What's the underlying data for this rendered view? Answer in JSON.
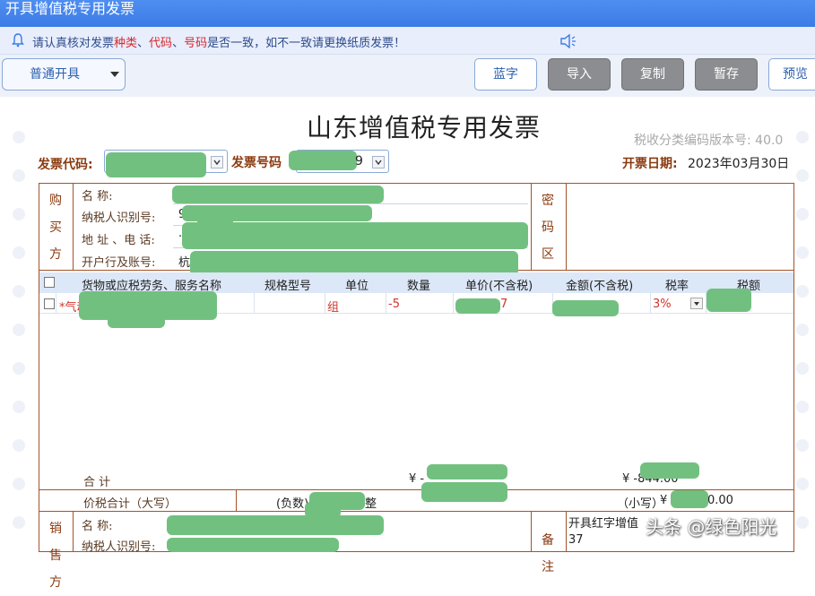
{
  "window": {
    "title": "开具增值税专用发票"
  },
  "notice": {
    "prefix": "请认真核对发票",
    "kind": "种类",
    "sep1": "、",
    "code": "代码",
    "sep2": "、",
    "number": "号码",
    "suffix": "是否一致，如不一致请更换纸质发票！"
  },
  "toolbar": {
    "mode_select": "普通开具",
    "buttons": {
      "blue": "蓝字",
      "import": "导入",
      "copy": "复制",
      "save_draft": "暂存",
      "preview": "预览"
    }
  },
  "invoice": {
    "title": "山东增值税专用发票",
    "version": "税收分类编码版本号: 40.0",
    "code_label": "发票代码:",
    "number_label": "发票号码",
    "number_tail": "9",
    "date_label": "开票日期:",
    "date_value": "2023年03月30日",
    "buyer": {
      "side_label": "购买方",
      "fields": {
        "name": "名          称:",
        "tax_id": "纳税人识别号:",
        "address": "地 址 、电 话:",
        "bank": "开户行及账号:"
      },
      "address_prefix": "·",
      "bank_prefix": "杭",
      "tax_prefix": "9"
    },
    "cipher_label": "密码区",
    "table": {
      "headers": [
        "货物或应税劳务、服务名称",
        "规格型号",
        "单位",
        "数量",
        "单价(不含税)",
        "金额(不含税)",
        "税率",
        "税额"
      ],
      "rows": [
        {
          "name": "*气动元件",
          "spec": "",
          "unit": "组",
          "qty": "-5",
          "price": "7",
          "amount": "",
          "rate": "3%",
          "tax": ""
        }
      ]
    },
    "totals": {
      "label": "合          计",
      "amount_prefix": "¥ -",
      "tax_value": "¥ -844.00"
    },
    "price_tax_total": {
      "label": "价税合计（大写）",
      "upper": "(负数)",
      "upper_suffix": "整",
      "lower_label": "（小写）",
      "lower_value": "¥ -",
      "lower_tail": "0.00"
    },
    "seller": {
      "side_label": "销售方",
      "fields": {
        "name": "名          称:",
        "tax_id": "纳税人识别号:"
      }
    },
    "remark": {
      "side_label": "备注",
      "line1": "开具红字增值",
      "line2": "37"
    }
  },
  "watermark": "头条 @绿色阳光"
}
